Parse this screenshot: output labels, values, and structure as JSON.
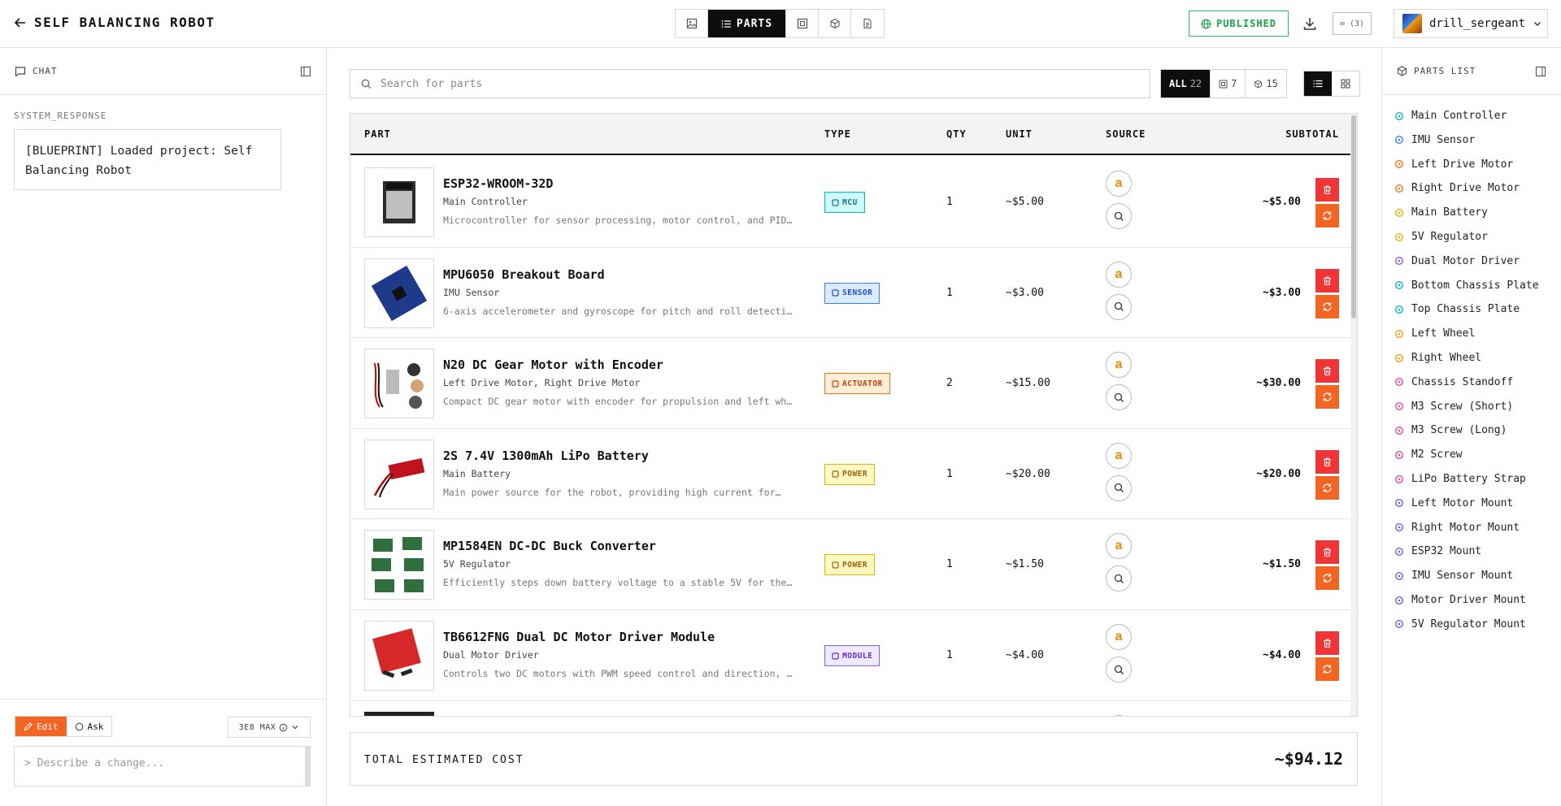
{
  "header": {
    "back_icon": "arrow-left-icon",
    "project_title": "SELF BALANCING ROBOT",
    "tabs": [
      {
        "icon": "image-icon",
        "label": ""
      },
      {
        "icon": "list-icon",
        "label": "PARTS"
      },
      {
        "icon": "schematic-icon",
        "label": ""
      },
      {
        "icon": "cube-icon",
        "label": ""
      },
      {
        "icon": "document-icon",
        "label": ""
      }
    ],
    "published_label": "PUBLISHED",
    "infinity_label": "∞ (3)",
    "username": "drill_sergeant"
  },
  "chat": {
    "title": "CHAT",
    "system_label": "SYSTEM_RESPONSE",
    "system_message": "[BLUEPRINT] Loaded project: Self Balancing Robot",
    "mode_edit": "Edit",
    "mode_ask": "Ask",
    "model_label": "3E8 MAX",
    "input_placeholder": "> Describe a change..."
  },
  "search": {
    "placeholder": "Search for parts"
  },
  "filters": {
    "all_label": "ALL",
    "all_count": "22",
    "pcb_count": "7",
    "cad_count": "15"
  },
  "table": {
    "headers": {
      "part": "PART",
      "type": "TYPE",
      "qty": "QTY",
      "unit": "UNIT",
      "source": "SOURCE",
      "subtotal": "SUBTOTAL"
    },
    "rows": [
      {
        "name": "ESP32-WROOM-32D",
        "role": "Main Controller",
        "desc": "Microcontroller for sensor processing, motor control, and PID…",
        "type": "MCU",
        "qty": "1",
        "unit": "~$5.00",
        "subtotal": "~$5.00"
      },
      {
        "name": "MPU6050 Breakout Board",
        "role": "IMU Sensor",
        "desc": "6-axis accelerometer and gyroscope for pitch and roll detection,…",
        "type": "SENSOR",
        "qty": "1",
        "unit": "~$3.00",
        "subtotal": "~$3.00"
      },
      {
        "name": "N20 DC Gear Motor with Encoder",
        "role": "Left Drive Motor, Right Drive Motor",
        "desc": "Compact DC gear motor with encoder for propulsion and left wheel…",
        "type": "ACTUATOR",
        "qty": "2",
        "unit": "~$15.00",
        "subtotal": "~$30.00"
      },
      {
        "name": "2S 7.4V 1300mAh LiPo Battery",
        "role": "Main Battery",
        "desc": "Main power source for the robot, providing high current for…",
        "type": "POWER",
        "qty": "1",
        "unit": "~$20.00",
        "subtotal": "~$20.00"
      },
      {
        "name": "MP1584EN DC-DC Buck Converter",
        "role": "5V Regulator",
        "desc": "Efficiently steps down battery voltage to a stable 5V for the…",
        "type": "POWER",
        "qty": "1",
        "unit": "~$1.50",
        "subtotal": "~$1.50"
      },
      {
        "name": "TB6612FNG Dual DC Motor Driver Module",
        "role": "Dual Motor Driver",
        "desc": "Controls two DC motors with PWM speed control and direction, mor…",
        "type": "MODULE",
        "qty": "1",
        "unit": "~$4.00",
        "subtotal": "~$4.00"
      }
    ]
  },
  "total": {
    "label": "TOTAL ESTIMATED COST",
    "value": "~$94.12"
  },
  "parts_list": {
    "title": "PARTS LIST",
    "items": [
      {
        "label": "Main Controller",
        "color": "#06b6d4"
      },
      {
        "label": "IMU Sensor",
        "color": "#3b82f6"
      },
      {
        "label": "Left Drive Motor",
        "color": "#f97316"
      },
      {
        "label": "Right Drive Motor",
        "color": "#f97316"
      },
      {
        "label": "Main Battery",
        "color": "#eab308"
      },
      {
        "label": "5V Regulator",
        "color": "#eab308"
      },
      {
        "label": "Dual Motor Driver",
        "color": "#8b5cf6"
      },
      {
        "label": "Bottom Chassis Plate",
        "color": "#06b6d4"
      },
      {
        "label": "Top Chassis Plate",
        "color": "#06b6d4"
      },
      {
        "label": "Left Wheel",
        "color": "#f59e0b"
      },
      {
        "label": "Right Wheel",
        "color": "#f59e0b"
      },
      {
        "label": "Chassis Standoff",
        "color": "#ec4899"
      },
      {
        "label": "M3 Screw (Short)",
        "color": "#ec4899"
      },
      {
        "label": "M3 Screw (Long)",
        "color": "#ec4899"
      },
      {
        "label": "M2 Screw",
        "color": "#ec4899"
      },
      {
        "label": "LiPo Battery Strap",
        "color": "#ec4899"
      },
      {
        "label": "Left Motor Mount",
        "color": "#6366f1"
      },
      {
        "label": "Right Motor Mount",
        "color": "#6366f1"
      },
      {
        "label": "ESP32 Mount",
        "color": "#6366f1"
      },
      {
        "label": "IMU Sensor Mount",
        "color": "#6366f1"
      },
      {
        "label": "Motor Driver Mount",
        "color": "#6366f1"
      },
      {
        "label": "5V Regulator Mount",
        "color": "#6366f1"
      }
    ]
  }
}
